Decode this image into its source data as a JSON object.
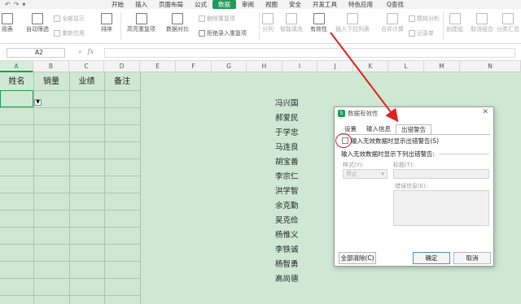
{
  "menubar": {
    "items": [
      {
        "label": "开始",
        "active": false
      },
      {
        "label": "插入",
        "active": false
      },
      {
        "label": "页面布局",
        "active": false
      },
      {
        "label": "公式",
        "active": false
      },
      {
        "label": "数据",
        "active": true
      },
      {
        "label": "审阅",
        "active": false
      },
      {
        "label": "视图",
        "active": false
      },
      {
        "label": "安全",
        "active": false
      },
      {
        "label": "开发工具",
        "active": false
      },
      {
        "label": "特色应用",
        "active": false
      }
    ],
    "search": "Q查找"
  },
  "ribbon": {
    "pivot": "视表",
    "autofilter": "自动筛选",
    "show_all": "全部显示",
    "reapply": "重新应用",
    "sort": "排序",
    "highlight_dup": "高亮重复项",
    "compare": "数据对比",
    "delete_dup": "删除重复项",
    "reject_dup": "拒绝录入重复项",
    "split": "分列",
    "smart_fill": "智能填充",
    "validity": "有效性",
    "insert_dropdown": "插入下拉列表",
    "merge_calc": "合并计算",
    "simulate": "模拟分析",
    "record": "记录单",
    "create_group": "创建组",
    "ungroup": "取消组合",
    "subtotal": "分类汇总"
  },
  "formulabar": {
    "cell_ref": "A2",
    "fx": "fx"
  },
  "grid": {
    "columns": [
      "A",
      "B",
      "C",
      "D",
      "E",
      "F",
      "G",
      "H",
      "I",
      "J",
      "K",
      "L",
      "M",
      "N"
    ],
    "headers": [
      "姓名",
      "销量",
      "业绩",
      "备注"
    ],
    "names": [
      "冯兴国",
      "郝爱民",
      "于学忠",
      "马连良",
      "胡宝善",
      "李宗仁",
      "洪学智",
      "余克勤",
      "吴克俭",
      "杨惟义",
      "李铁诚",
      "杨智勇",
      "高尚德"
    ]
  },
  "dialog": {
    "title": "数据有效性",
    "tabs": [
      "设置",
      "输入信息",
      "出错警告"
    ],
    "active_tab": "出错警告",
    "checkbox_label": "输入无效数据时显示出错警告(S)",
    "group_label": "输入无效数据时显示下列出错警告:",
    "style_label": "样式(Y):",
    "style_value": "停止",
    "title_label": "标题(T):",
    "message_label": "错误信息(E):",
    "clear_all": "全部清除(C)",
    "ok": "确定",
    "cancel": "取消"
  },
  "colors": {
    "accent": "#1e9b58",
    "grid_bg": "#cfe8d3",
    "annotation": "#e02020"
  }
}
